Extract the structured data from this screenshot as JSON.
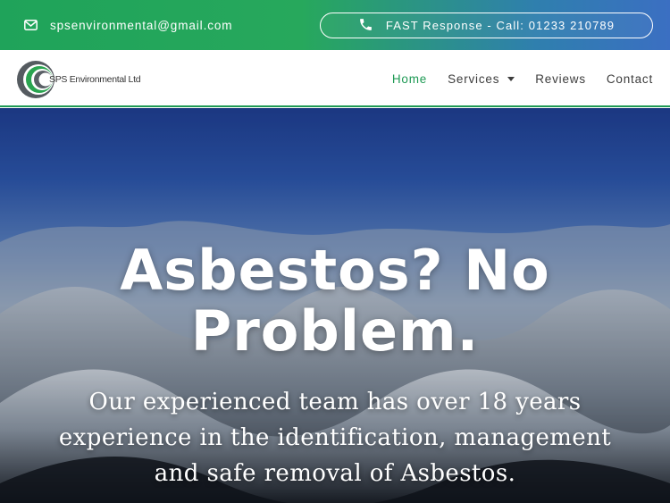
{
  "topbar": {
    "email": "spsenvironmental@gmail.com",
    "email_icon": "envelope-icon",
    "call_label": "FAST Response - Call: 01233 210789",
    "phone_icon": "phone-icon",
    "gradient": [
      "#1fa35a",
      "#3b6fc2"
    ]
  },
  "header": {
    "logo_text": "SPS Environmental Ltd",
    "nav": [
      {
        "label": "Home",
        "active": true
      },
      {
        "label": "Services",
        "has_dropdown": true
      },
      {
        "label": "Reviews"
      },
      {
        "label": "Contact"
      }
    ],
    "accent_color": "#1f9a55"
  },
  "hero": {
    "title_line1": "Asbestos? No",
    "title_line2": "Problem.",
    "subtitle_line1": "Our experienced team has over 18 years",
    "subtitle_line2": "experience in the identification, management",
    "subtitle_line3": "and safe removal of Asbestos."
  }
}
